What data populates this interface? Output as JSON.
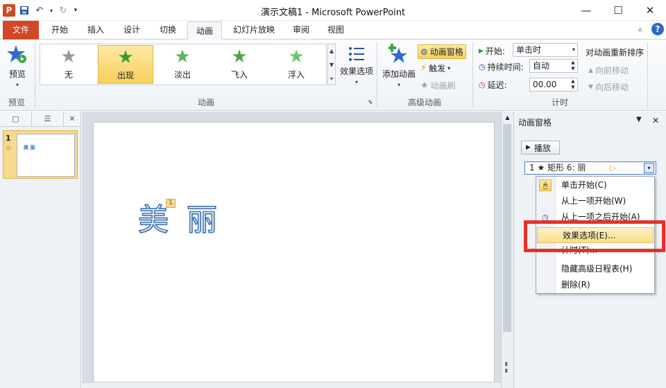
{
  "app": {
    "title": "演示文稿1 - Microsoft PowerPoint",
    "logo_letter": "P"
  },
  "qat": {
    "save_icon": "save-icon",
    "undo_icon": "undo-icon",
    "redo_icon": "redo-icon"
  },
  "tabs": [
    {
      "label": "文件"
    },
    {
      "label": "开始"
    },
    {
      "label": "插入"
    },
    {
      "label": "设计"
    },
    {
      "label": "切换"
    },
    {
      "label": "动画"
    },
    {
      "label": "幻灯片放映"
    },
    {
      "label": "审阅"
    },
    {
      "label": "视图"
    }
  ],
  "ribbon": {
    "preview": {
      "label": "预览",
      "group": "预览"
    },
    "animations": {
      "items": [
        {
          "label": "无",
          "color": "#9a9a9a"
        },
        {
          "label": "出现",
          "color": "#3a9a3a"
        },
        {
          "label": "淡出",
          "color": "#5db35d"
        },
        {
          "label": "飞入",
          "color": "#4aa84a"
        },
        {
          "label": "浮入",
          "color": "#6ec46e"
        }
      ],
      "effect_options": "效果选项",
      "group": "动画"
    },
    "advanced": {
      "add_animation": "添加动画",
      "animation_pane": "动画窗格",
      "trigger": "触发",
      "painter": "动画刷",
      "group": "高级动画"
    },
    "timing": {
      "start_label": "开始:",
      "start_value": "单击时",
      "duration_label": "持续时间:",
      "duration_value": "自动",
      "delay_label": "延迟:",
      "delay_value": "00.00",
      "reorder": "对动画重新排序",
      "move_earlier": "向前移动",
      "move_later": "向后移动",
      "group": "计时"
    }
  },
  "slide_pane": {
    "slide_number": "1",
    "thumb_text": "美 丽"
  },
  "slide": {
    "text": "美 丽",
    "badge": "1"
  },
  "anim_pane": {
    "title": "动画窗格",
    "play": "播放",
    "entry": "1 ★ 矩形 6: 丽",
    "menu": [
      "单击开始(C)",
      "从上一项开始(W)",
      "从上一项之后开始(A)",
      "效果选项(E)...",
      "计时(T)...",
      "隐藏高级日程表(H)",
      "删除(R)"
    ]
  },
  "colors": {
    "file_tab": "#d24726",
    "highlight": "#f8cf5a",
    "callout": "#e8302a",
    "slide_text": "#3b6fb0"
  }
}
